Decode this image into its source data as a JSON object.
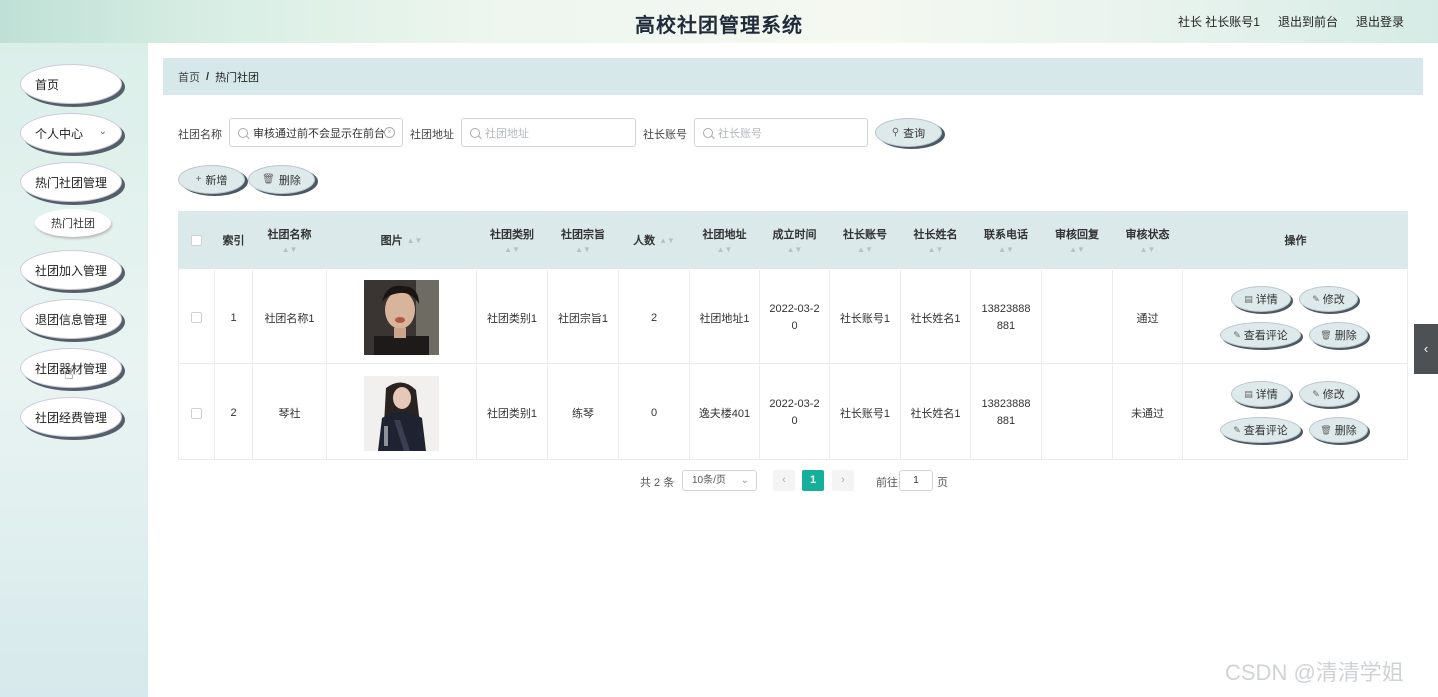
{
  "header": {
    "title": "高校社团管理系统",
    "user": "社长 社长账号1",
    "to_front": "退出到前台",
    "logout": "退出登录"
  },
  "sidebar": {
    "items": [
      {
        "label": "首页"
      },
      {
        "label": "个人中心",
        "chevron": "chevron-down-icon"
      },
      {
        "label": "热门社团管理"
      },
      {
        "label": "社团加入管理"
      },
      {
        "label": "退团信息管理"
      },
      {
        "label": "社团器材管理"
      },
      {
        "label": "社团经费管理"
      }
    ],
    "sub_item": "热门社团"
  },
  "breadcrumb": {
    "home": "首页",
    "sep": "/",
    "current": "热门社团"
  },
  "search": {
    "name_label": "社团名称",
    "name_value": "审核通过前不会显示在前台",
    "address_label": "社团地址",
    "address_placeholder": "社团地址",
    "account_label": "社长账号",
    "account_placeholder": "社长账号",
    "query_button": "查询"
  },
  "actions": {
    "add": "新增",
    "delete": "删除"
  },
  "table": {
    "headers": [
      "索引",
      "社团名称",
      "图片",
      "社团类别",
      "社团宗旨",
      "人数",
      "社团地址",
      "成立时间",
      "社长账号",
      "社长姓名",
      "联系电话",
      "审核回复",
      "审核状态",
      "操作"
    ],
    "rows": [
      {
        "index": "1",
        "name": "社团名称1",
        "category": "社团类别1",
        "purpose": "社团宗旨1",
        "count": "2",
        "address": "社团地址1",
        "date1": "2022-03-2",
        "date2": "0",
        "account": "社长账号1",
        "leader": "社长姓名1",
        "phone1": "13823888",
        "phone2": "881",
        "reply": "",
        "status": "通过"
      },
      {
        "index": "2",
        "name": "琴社",
        "category": "社团类别1",
        "purpose": "练琴",
        "count": "0",
        "address": "逸夫楼401",
        "date1": "2022-03-2",
        "date2": "0",
        "account": "社长账号1",
        "leader": "社长姓名1",
        "phone1": "13823888",
        "phone2": "881",
        "reply": "",
        "status": "未通过"
      }
    ],
    "ops": {
      "detail": "详情",
      "edit": "修改",
      "comments": "查看评论",
      "delete": "删除"
    }
  },
  "pagination": {
    "total": "共 2 条",
    "page_size": "10条/页",
    "current": "1",
    "goto_label": "前往",
    "goto_value": "1",
    "page_unit": "页"
  },
  "watermark": "CSDN @清清学姐"
}
